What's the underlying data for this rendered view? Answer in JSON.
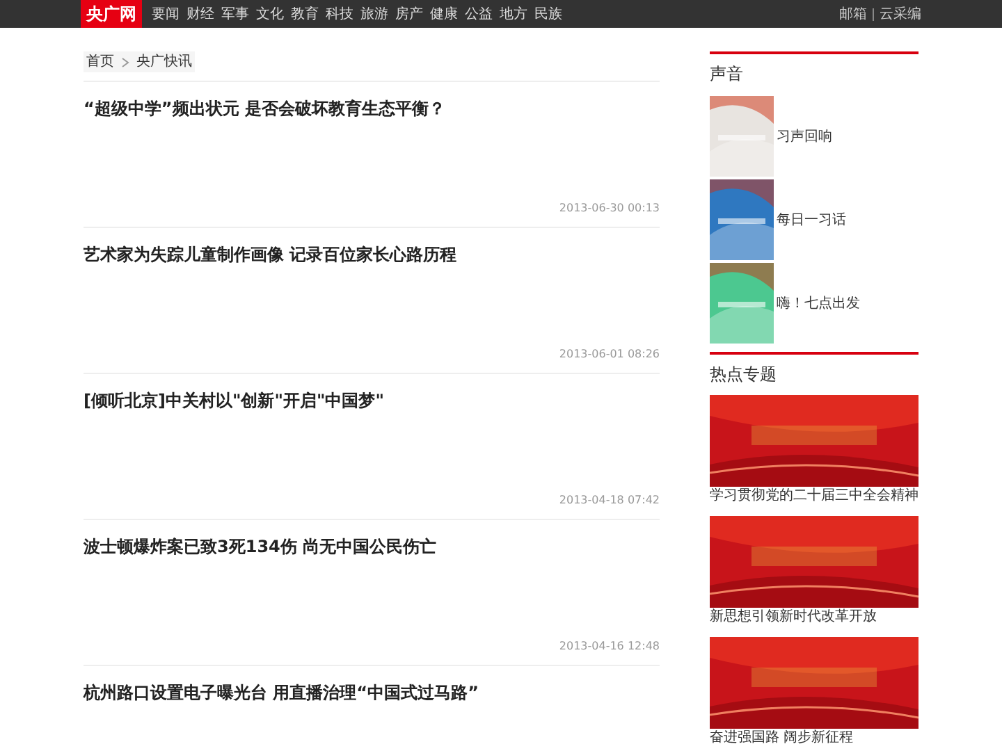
{
  "header": {
    "logo": "央广网",
    "nav": [
      "要闻",
      "财经",
      "军事",
      "文化",
      "教育",
      "科技",
      "旅游",
      "房产",
      "健康",
      "公益",
      "地方",
      "民族"
    ],
    "links": [
      "邮箱",
      "云采编"
    ]
  },
  "breadcrumb": [
    "首页",
    "央广快讯"
  ],
  "articles": [
    {
      "title": "“超级中学”频出状元 是否会破坏教育生态平衡？",
      "date": "2013-06-30 00:13"
    },
    {
      "title": "艺术家为失踪儿童制作画像 记录百位家长心路历程",
      "date": "2013-06-01 08:26"
    },
    {
      "title": "[倾听北京]中关村以\"创新\"开启\"中国梦\"",
      "date": "2013-04-18 07:42"
    },
    {
      "title": "波士顿爆炸案已致3死134伤 尚无中国公民伤亡",
      "date": "2013-04-16 12:48"
    },
    {
      "title": "杭州路口设置电子曝光台 用直播治理“中国式过马路”"
    }
  ],
  "sound": {
    "heading": "声音",
    "items": [
      {
        "title": "习声回响",
        "color": "#e8e4e0"
      },
      {
        "title": "每日一习话",
        "color": "#2f78c0"
      },
      {
        "title": "嗨！七点出发",
        "color": "#4cc890"
      }
    ]
  },
  "topics": {
    "heading": "热点专题",
    "items": [
      {
        "caption": "学习贯彻党的二十届三中全会精神"
      },
      {
        "caption": "新思想引领新时代改革开放"
      },
      {
        "caption": "奋进强国路 阔步新征程"
      }
    ]
  }
}
